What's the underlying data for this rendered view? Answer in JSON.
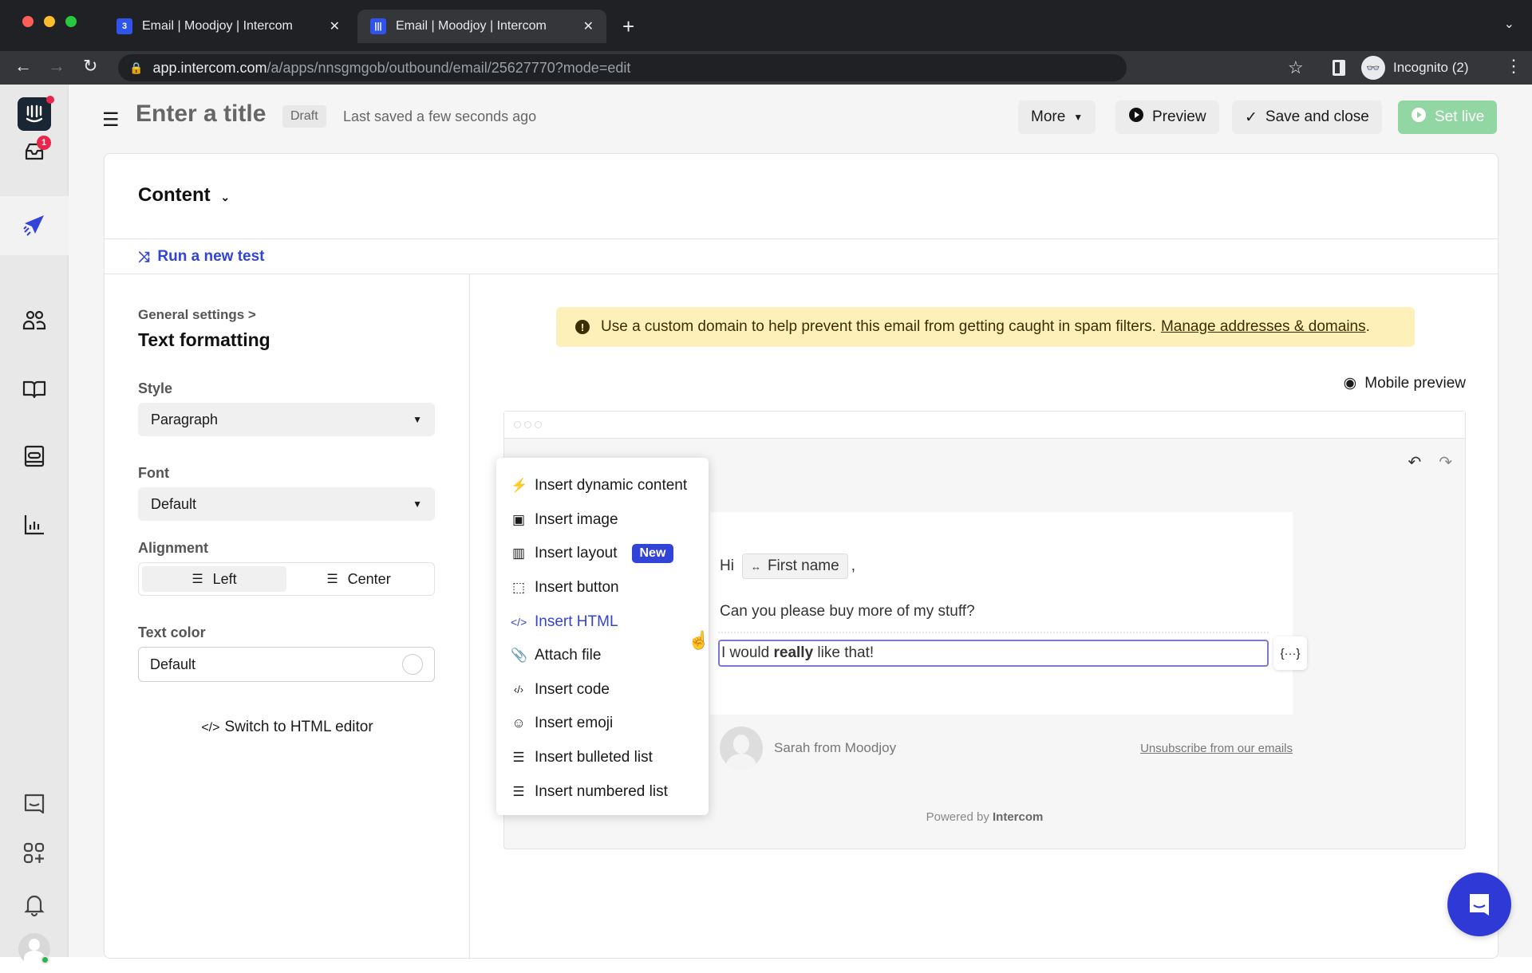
{
  "browser": {
    "tabs": [
      {
        "title": "Email | Moodjoy | Intercom",
        "badge": "3",
        "active": false
      },
      {
        "title": "Email | Moodjoy | Intercom",
        "active": true
      }
    ],
    "new_tab_label": "+",
    "url_host": "app.intercom.com",
    "url_path": "/a/apps/nnsgmgob/outbound/email/25627770?mode=edit",
    "profile_label": "Incognito (2)"
  },
  "sidebar": {
    "inbox_badge": "1",
    "items": [
      {
        "name": "inbox",
        "icon": "inbox-icon"
      },
      {
        "name": "outbound",
        "icon": "paper-plane-icon",
        "active": true
      },
      {
        "name": "contacts",
        "icon": "people-icon"
      },
      {
        "name": "articles",
        "icon": "book-icon"
      },
      {
        "name": "inbox-tickets",
        "icon": "ticket-icon"
      },
      {
        "name": "reports",
        "icon": "bar-chart-icon"
      },
      {
        "name": "messenger",
        "icon": "chat-icon"
      },
      {
        "name": "apps",
        "icon": "app-grid-icon"
      },
      {
        "name": "notifications",
        "icon": "bell-icon"
      },
      {
        "name": "profile",
        "icon": "avatar-icon"
      }
    ]
  },
  "header": {
    "title_placeholder": "Enter a title",
    "status": "Draft",
    "saved_text": "Last saved a few seconds ago",
    "more_label": "More",
    "preview_label": "Preview",
    "save_close_label": "Save and close",
    "set_live_label": "Set live"
  },
  "content": {
    "heading": "Content",
    "run_test_label": "Run a new test"
  },
  "formatting": {
    "breadcrumb": "General settings >",
    "title": "Text formatting",
    "style_label": "Style",
    "style_value": "Paragraph",
    "font_label": "Font",
    "font_value": "Default",
    "alignment_label": "Alignment",
    "align_left": "Left",
    "align_center": "Center",
    "text_color_label": "Text color",
    "text_color_value": "Default",
    "html_editor_label": "Switch to HTML editor"
  },
  "editor": {
    "warning_text": "Use a custom domain to help prevent this email from getting caught in spam filters.",
    "warning_link": "Manage addresses & domains",
    "warning_end": ".",
    "mobile_preview_label": "Mobile preview",
    "greeting": "Hi",
    "attribute_chip": "First name",
    "greeting_end": ",",
    "line2": "Can you please buy more of my stuff?",
    "line3_pre": "I would ",
    "line3_bold": "really",
    "line3_post": " like that!",
    "sender": "Sarah from Moodjoy",
    "unsubscribe": "Unsubscribe from our emails",
    "powered_prefix": "Powered by",
    "powered_brand": "Intercom"
  },
  "insert_menu": {
    "items": [
      {
        "label": "Insert dynamic content",
        "icon": "lightning-icon"
      },
      {
        "label": "Insert image",
        "icon": "image-icon"
      },
      {
        "label": "Insert layout",
        "icon": "columns-icon",
        "badge": "New"
      },
      {
        "label": "Insert button",
        "icon": "button-cursor-icon"
      },
      {
        "label": "Insert HTML",
        "icon": "code-icon",
        "highlighted": true
      },
      {
        "label": "Attach file",
        "icon": "paperclip-icon"
      },
      {
        "label": "Insert code",
        "icon": "code-block-icon"
      },
      {
        "label": "Insert emoji",
        "icon": "smiley-icon"
      },
      {
        "label": "Insert bulleted list",
        "icon": "bulleted-list-icon"
      },
      {
        "label": "Insert numbered list",
        "icon": "numbered-list-icon"
      }
    ]
  },
  "colors": {
    "accent": "#3243d8",
    "set_live": "#92d6a3",
    "warning_bg": "#fdf0b8",
    "badge": "#e8254b"
  }
}
